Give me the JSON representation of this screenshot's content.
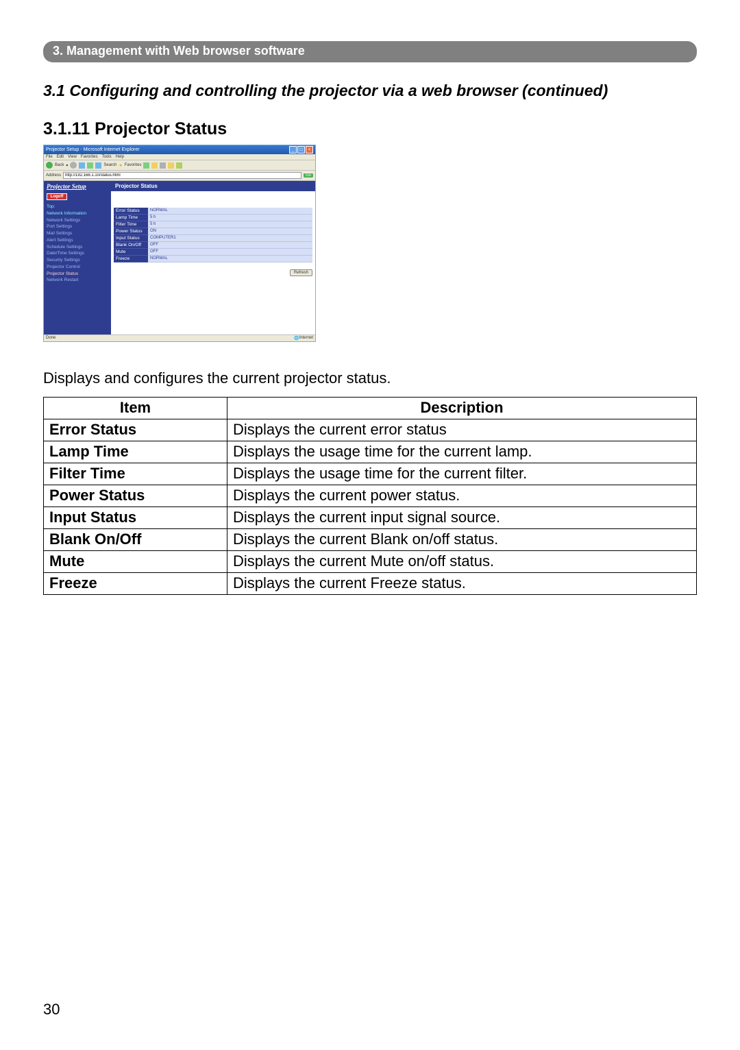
{
  "chapter": "3. Management with Web browser software",
  "section_title": "3.1 Configuring and controlling the projector via a web browser (continued)",
  "subsection_title": "3.1.11 Projector Status",
  "body_text": "Displays and configures the current projector status.",
  "page_number": "30",
  "shot": {
    "window_title": "Projector Setup - Microsoft Internet Explorer",
    "menu": [
      "File",
      "Edit",
      "View",
      "Favorites",
      "Tools",
      "Help"
    ],
    "toolbar": {
      "back": "Back",
      "search": "Search",
      "favorites": "Favorites"
    },
    "address_label": "Address",
    "address_value": "http://192.168.1.10/status.html",
    "go": "Go",
    "nav_header": "Projector Setup",
    "logoff": "Logoff",
    "nav_items": [
      {
        "label": "Top:",
        "cls": "cyan"
      },
      {
        "label": "Network Information",
        "cls": "cyan"
      },
      {
        "label": "Network Settings",
        "cls": ""
      },
      {
        "label": "Port Settings",
        "cls": ""
      },
      {
        "label": "Mail Settings",
        "cls": ""
      },
      {
        "label": "Alert Settings",
        "cls": ""
      },
      {
        "label": "Schedule Settings",
        "cls": ""
      },
      {
        "label": "Date/Time Settings",
        "cls": ""
      },
      {
        "label": "Security Settings",
        "cls": ""
      },
      {
        "label": "Projector Control",
        "cls": ""
      },
      {
        "label": "Projector Status",
        "cls": "active"
      },
      {
        "label": "Network Restart",
        "cls": ""
      }
    ],
    "panel_title": "Projector Status",
    "status_rows": [
      {
        "k": "Error Status",
        "v": "NORMAL"
      },
      {
        "k": "Lamp Time",
        "v": "5 h"
      },
      {
        "k": "Filter Time",
        "v": "5 h"
      },
      {
        "k": "Power Status",
        "v": "ON"
      },
      {
        "k": "Input Status",
        "v": "COMPUTER1"
      },
      {
        "k": "Blank On/Off",
        "v": "OFF"
      },
      {
        "k": "Mute",
        "v": "OFF"
      },
      {
        "k": "Freeze",
        "v": "NORMAL"
      }
    ],
    "refresh": "Refresh",
    "done": "Done",
    "zone": "Internet"
  },
  "table": {
    "headers": {
      "item": "Item",
      "desc": "Description"
    },
    "rows": [
      {
        "item": "Error Status",
        "desc": "Displays the current error status"
      },
      {
        "item": "Lamp Time",
        "desc": "Displays the usage time for the current lamp."
      },
      {
        "item": "Filter Time",
        "desc": "Displays the usage time for the current filter."
      },
      {
        "item": "Power Status",
        "desc": "Displays the current power status."
      },
      {
        "item": "Input Status",
        "desc": "Displays the current input signal source."
      },
      {
        "item": "Blank On/Off",
        "desc": "Displays the current Blank on/off status."
      },
      {
        "item": "Mute",
        "desc": "Displays the current Mute on/off status."
      },
      {
        "item": "Freeze",
        "desc": "Displays the current Freeze status."
      }
    ]
  }
}
